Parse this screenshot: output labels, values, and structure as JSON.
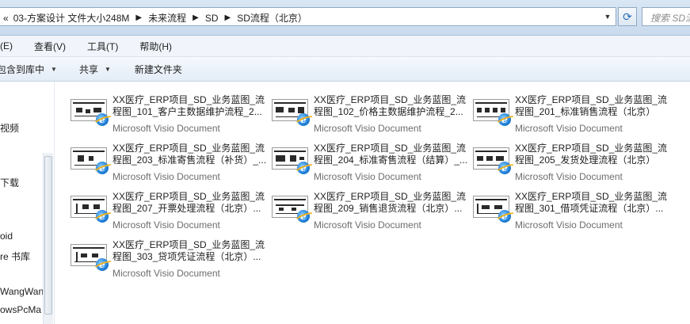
{
  "address": {
    "crumbs": [
      "03-方案设计 文件大小248M",
      "未来流程",
      "SD",
      "SD流程（北京）"
    ],
    "back_glyph": "«",
    "sep_glyph": "▶",
    "search_placeholder": "搜索 SD流"
  },
  "menu": [
    "(E)",
    "查看(V)",
    "工具(T)",
    "帮助(H)"
  ],
  "toolbar": {
    "include_label": "包含到库中",
    "share_label": "共享",
    "new_folder_label": "新建文件夹"
  },
  "nav": [
    "视频",
    "下载",
    "oid",
    "re 书库",
    "WangWan",
    "owsPcMa"
  ],
  "files": [
    {
      "line1": "XX医疗_ERP项目_SD_业务蓝图_流",
      "line2": "程图_101_客户主数据维护流程_2...",
      "type": "Microsoft Visio Document"
    },
    {
      "line1": "XX医疗_ERP项目_SD_业务蓝图_流",
      "line2": "程图_102_价格主数据维护流程_2...",
      "type": "Microsoft Visio Document"
    },
    {
      "line1": "XX医疗_ERP项目_SD_业务蓝图_流",
      "line2": "程图_201_标准销售流程（北京）",
      "type": "Microsoft Visio Document"
    },
    {
      "line1": "XX医疗_ERP项目_SD_业务蓝图_流",
      "line2": "程图_203_标准寄售流程（补货）_...",
      "type": "Microsoft Visio Document"
    },
    {
      "line1": "XX医疗_ERP项目_SD_业务蓝图_流",
      "line2": "程图_204_标准寄售流程（结算）_...",
      "type": "Microsoft Visio Document"
    },
    {
      "line1": "XX医疗_ERP项目_SD_业务蓝图_流",
      "line2": "程图_205_发货处理流程（北京）",
      "type": "Microsoft Visio Document"
    },
    {
      "line1": "XX医疗_ERP项目_SD_业务蓝图_流",
      "line2": "程图_207_开票处理流程（北京）...",
      "type": "Microsoft Visio Document"
    },
    {
      "line1": "XX医疗_ERP项目_SD_业务蓝图_流",
      "line2": "程图_209_销售退货流程（北京）...",
      "type": "Microsoft Visio Document"
    },
    {
      "line1": "XX医疗_ERP项目_SD_业务蓝图_流",
      "line2": "程图_301_借项凭证流程（北京）...",
      "type": "Microsoft Visio Document"
    },
    {
      "line1": "XX医疗_ERP项目_SD_业务蓝图_流",
      "line2": "程图_303_贷项凭证流程（北京）...",
      "type": "Microsoft Visio Document"
    }
  ]
}
